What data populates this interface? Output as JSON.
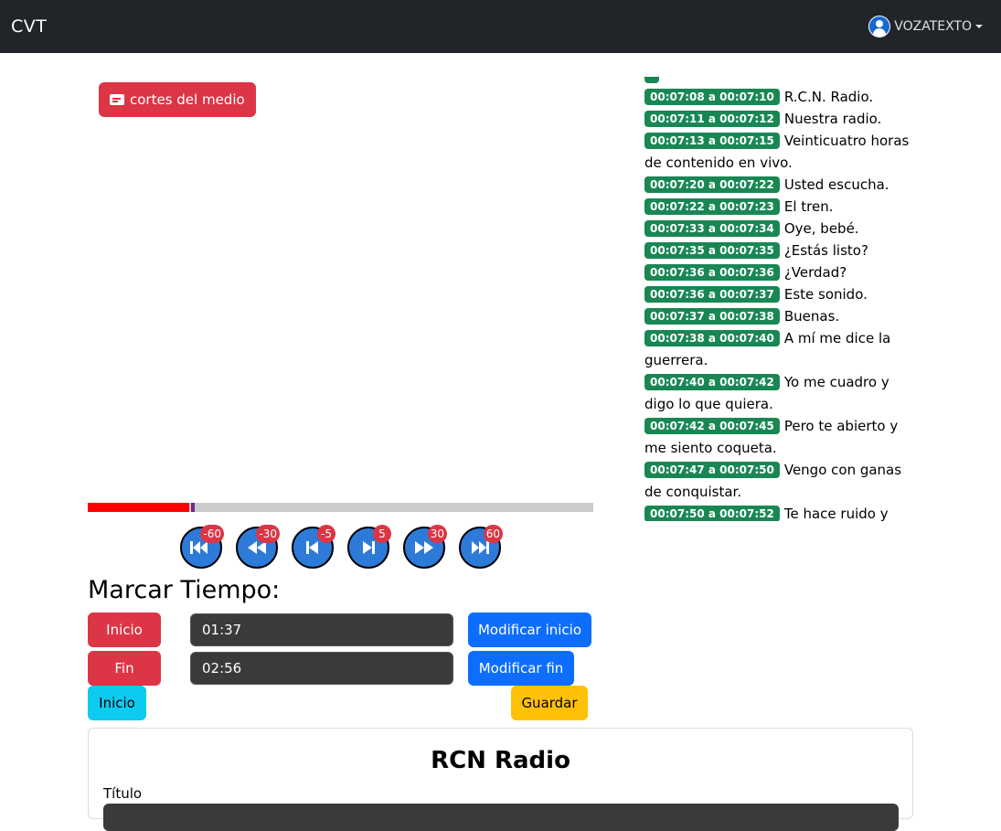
{
  "navbar": {
    "brand": "CVT",
    "user": "VOZATEXTO"
  },
  "cortes_button": {
    "label": "cortes del medio"
  },
  "player": {
    "progress": 0.2
  },
  "skip_buttons": [
    {
      "label": "-60",
      "icon": "skip-back-icon"
    },
    {
      "label": "-30",
      "icon": "rewind-icon"
    },
    {
      "label": "-5",
      "icon": "step-back-icon"
    },
    {
      "label": "5",
      "icon": "step-forward-icon"
    },
    {
      "label": "30",
      "icon": "fast-forward-icon"
    },
    {
      "label": "60",
      "icon": "skip-forward-icon"
    }
  ],
  "marcar": {
    "title": "Marcar Tiempo:",
    "inicio_label": "Inicio",
    "fin_label": "Fin",
    "inicio_value": "01:37",
    "fin_value": "02:56",
    "modificar_inicio": "Modificar inicio",
    "modificar_fin": "Modificar fin",
    "inicio2_label": "Inicio",
    "guardar_label": "Guardar"
  },
  "card": {
    "title": "RCN Radio",
    "label": "Título"
  },
  "transcript": [
    {
      "time": "00:07:08 a 00:07:10",
      "text": "R.C.N. Radio."
    },
    {
      "time": "00:07:11 a 00:07:12",
      "text": "Nuestra radio."
    },
    {
      "time": "00:07:13 a 00:07:15",
      "text": "Veinticuatro horas de contenido en vivo."
    },
    {
      "time": "00:07:20 a 00:07:22",
      "text": "Usted escucha."
    },
    {
      "time": "00:07:22 a 00:07:23",
      "text": "El tren."
    },
    {
      "time": "00:07:33 a 00:07:34",
      "text": "Oye, bebé."
    },
    {
      "time": "00:07:35 a 00:07:35",
      "text": "¿Estás listo?"
    },
    {
      "time": "00:07:36 a 00:07:36",
      "text": "¿Verdad?"
    },
    {
      "time": "00:07:36 a 00:07:37",
      "text": "Este sonido."
    },
    {
      "time": "00:07:37 a 00:07:38",
      "text": "Buenas."
    },
    {
      "time": "00:07:38 a 00:07:40",
      "text": "A mí me dice la guerrera."
    },
    {
      "time": "00:07:40 a 00:07:42",
      "text": "Yo me cuadro y digo lo que quiera."
    },
    {
      "time": "00:07:42 a 00:07:45",
      "text": "Pero te abierto y me siento coqueta."
    },
    {
      "time": "00:07:47 a 00:07:50",
      "text": "Vengo con ganas de conquistar."
    },
    {
      "time": "00:07:50 a 00:07:52",
      "text": "Te hace ruido y"
    }
  ]
}
